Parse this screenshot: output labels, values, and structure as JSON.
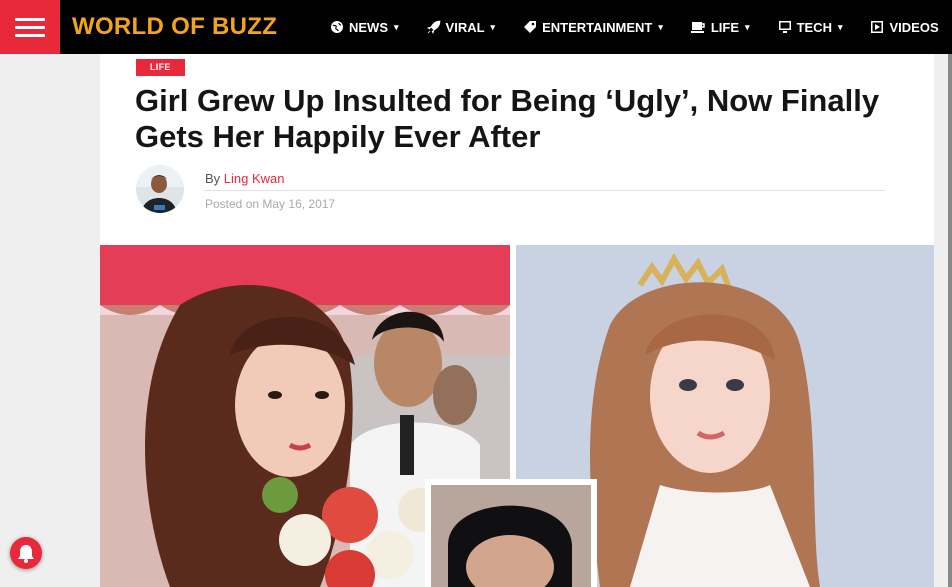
{
  "header": {
    "logo_text": "WORLD OF BUZZ",
    "nav": [
      {
        "label": "NEWS",
        "icon": "globe-icon"
      },
      {
        "label": "VIRAL",
        "icon": "rocket-icon"
      },
      {
        "label": "ENTERTAINMENT",
        "icon": "tag-icon"
      },
      {
        "label": "LIFE",
        "icon": "coffee-cup-icon"
      },
      {
        "label": "TECH",
        "icon": "desktop-icon"
      },
      {
        "label": "VIDEOS",
        "icon": "video-icon"
      }
    ]
  },
  "article": {
    "category": "LIFE",
    "title": "Girl Grew Up Insulted for Being ‘Ugly’, Now Finally Gets Her Happily Ever After",
    "by_prefix": "By",
    "author": "Ling Kwan",
    "posted_prefix": "Posted on",
    "date": "May 16, 2017"
  },
  "colors": {
    "accent": "#e8283b",
    "logo": "#f2a41c",
    "topbar": "#000000"
  }
}
